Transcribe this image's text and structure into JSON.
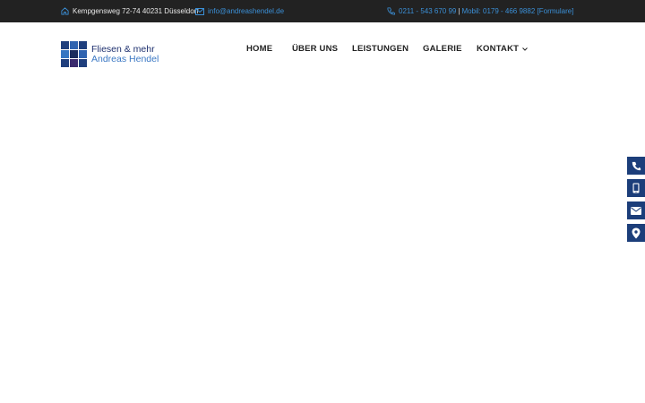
{
  "topbar": {
    "address": "Kempgensweg 72-74 40231 Düsseldorf",
    "email": "info@andreashendel.de",
    "phone": "0211 - 543 670 99",
    "separator": "|",
    "mobile": "Mobil: 0179 - 466 9882",
    "form_link": "[Formulare]",
    "icons": {
      "address": "house-icon",
      "email": "envelope-icon",
      "phone": "phone-icon"
    }
  },
  "logo": {
    "line1": "Fliesen & mehr",
    "line2": "Andreas Hendel",
    "tile_colors": [
      "#1f3f7d",
      "#2f63b0",
      "#1f3f7d",
      "#3576c2",
      "#1a2d5e",
      "#2f63b0",
      "#1f3f7d",
      "#3a2a6e",
      "#1f3f7d"
    ]
  },
  "nav": {
    "items": [
      {
        "label": "HOME"
      },
      {
        "label": "ÜBER UNS"
      },
      {
        "label": "LEISTUNGEN"
      },
      {
        "label": "GALERIE"
      },
      {
        "label": "KONTAKT",
        "has_dropdown": true
      }
    ]
  },
  "side_buttons": [
    {
      "icon": "phone-icon"
    },
    {
      "icon": "mobile-icon"
    },
    {
      "icon": "envelope-icon"
    },
    {
      "icon": "map-pin-icon"
    }
  ],
  "colors": {
    "topbar_bg": "#222222",
    "link": "#3b8fd6",
    "side_button_bg": "#1c3e7a",
    "nav_text": "#222222"
  }
}
